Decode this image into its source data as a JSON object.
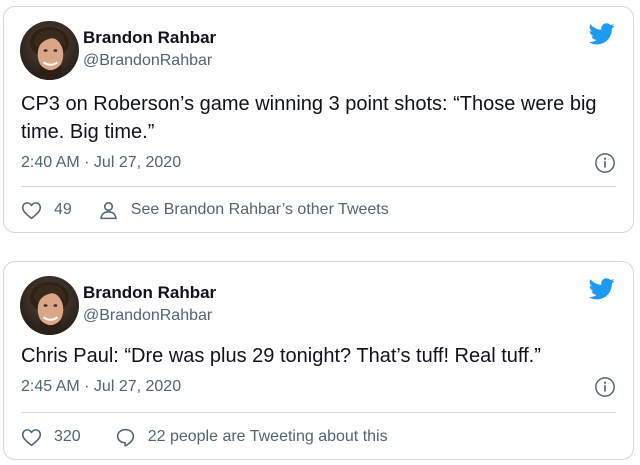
{
  "tweets": [
    {
      "author": {
        "name": "Brandon Rahbar",
        "handle": "@BrandonRahbar",
        "avatar_icon": "profile-photo"
      },
      "text": "CP3 on Roberson’s game winning 3 point shots: “Those were big time. Big time.”",
      "timestamp": "2:40 AM · Jul 27, 2020",
      "likes": "49",
      "secondary_action": {
        "icon": "person-icon",
        "label": "See Brandon Rahbar’s other Tweets"
      }
    },
    {
      "author": {
        "name": "Brandon Rahbar",
        "handle": "@BrandonRahbar",
        "avatar_icon": "profile-photo"
      },
      "text": "Chris Paul: “Dre was plus 29 tonight? That’s tuff! Real tuff.”",
      "timestamp": "2:45 AM · Jul 27, 2020",
      "likes": "320",
      "secondary_action": {
        "icon": "speech-bubble-icon",
        "label": "22 people are Tweeting about this"
      }
    }
  ],
  "colors": {
    "brand": "#1d9bf0",
    "text": "#0f1419",
    "muted": "#536471",
    "border": "#cfd9de"
  }
}
